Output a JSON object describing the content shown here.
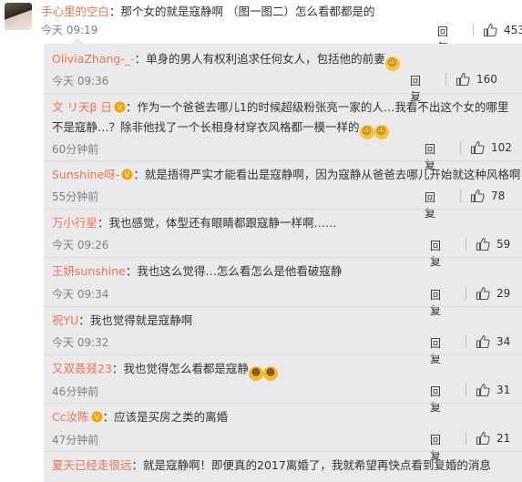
{
  "main": {
    "username": "手心里的空白",
    "text": "：那个女的就是寇静啊 （图一图二）怎么看都都是的",
    "time": "今天 09:19",
    "reply_label": "回复",
    "likes": "453"
  },
  "replies": [
    {
      "username": "OliviaZhang-_-",
      "text": "：单身的男人有权利追求任何女人，包括他的前妻",
      "time": "今天 09:36",
      "likes": "160",
      "emojis": [
        "smile-emoji"
      ]
    },
    {
      "username": "文 リ天β 日",
      "text": "：作为一个爸爸去哪儿1的时候超级粉张亮一家的人…我看不出这个女的哪里不是寇静…？除非他找了一个长相身材穿衣风格都一模一样的",
      "time": "60分钟前",
      "likes": "102",
      "vip": true,
      "emojis": [
        "shy-emoji",
        "shy-emoji"
      ]
    },
    {
      "username": "Sunshine呀-",
      "text": "：就是捂得严实才能看出是寇静啊，因为寇静从爸爸去哪儿开始就这种风格啊",
      "time": "55分钟前",
      "likes": "78",
      "vip": true
    },
    {
      "username": "万小行星",
      "text": "：我也感觉，体型还有眼睛都跟寇静一样啊……",
      "time": "今天 09:26",
      "likes": "59"
    },
    {
      "username": "王妍sunshine",
      "text": "：我也这么觉得…怎么看怎么是他看破寇静",
      "time": "今天 09:34",
      "likes": "29"
    },
    {
      "username": "祝YU",
      "text": "：我也觉得就是寇静啊",
      "time": "今天 09:32",
      "likes": "34"
    },
    {
      "username": "又双叒叕23",
      "text": "：我也觉得怎么看都是寇静",
      "time": "46分钟前",
      "likes": "31",
      "emojis": [
        "laugh-cry-emoji",
        "laugh-cry-emoji"
      ]
    },
    {
      "username": "Cc汝陈",
      "text": "：应该是买房之类的离婚",
      "time": "47分钟前",
      "likes": "21",
      "vip": true
    },
    {
      "username": "夏天已经走很远",
      "text": "：就是寇静啊！即便真的2017离婚了，我就希望再快点看到复婚的消息",
      "time": "",
      "likes": ""
    }
  ],
  "reply_label": "回复",
  "colors": {
    "username": "#eb7350",
    "background": "#eaeaec",
    "muted": "#808080"
  }
}
